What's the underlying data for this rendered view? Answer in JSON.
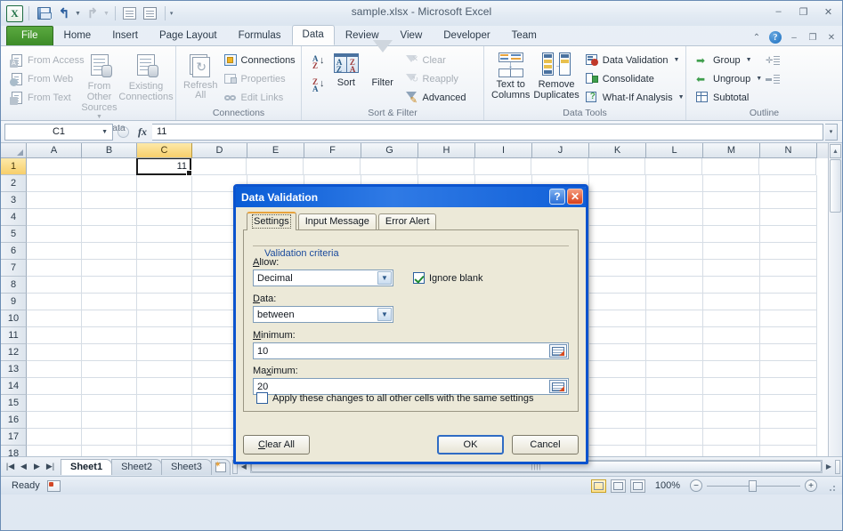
{
  "window": {
    "title": "sample.xlsx - Microsoft Excel",
    "minimize": "–",
    "maximize": "❐",
    "close": "✕"
  },
  "quick_access": {
    "logo": "X",
    "save": "save-icon",
    "undo": "↰",
    "redo": "↳",
    "customize": "▾"
  },
  "ribbon": {
    "tabs": [
      {
        "label": "File",
        "kind": "file"
      },
      {
        "label": "Home",
        "kind": "normal"
      },
      {
        "label": "Insert",
        "kind": "normal"
      },
      {
        "label": "Page Layout",
        "kind": "normal"
      },
      {
        "label": "Formulas",
        "kind": "normal"
      },
      {
        "label": "Data",
        "kind": "active"
      },
      {
        "label": "Review",
        "kind": "normal"
      },
      {
        "label": "View",
        "kind": "normal"
      },
      {
        "label": "Developer",
        "kind": "normal"
      },
      {
        "label": "Team",
        "kind": "normal"
      }
    ],
    "right_controls": {
      "collapse_ribbon": "⌃",
      "help": "?",
      "minimize_window": "–",
      "restore_window": "❐",
      "close_window": "✕"
    },
    "groups": [
      {
        "title": "Get External Data",
        "small": [
          "From Access",
          "From Web",
          "From Text"
        ],
        "large": [
          "From Other Sources",
          "Existing Connections"
        ]
      },
      {
        "title": "Connections",
        "refresh": "Refresh All",
        "small": [
          "Connections",
          "Properties",
          "Edit Links"
        ]
      },
      {
        "title": "Sort & Filter",
        "sort_az": "A→Z",
        "sort_za": "Z→A",
        "sort": "Sort",
        "filter": "Filter",
        "small": [
          "Clear",
          "Reapply",
          "Advanced"
        ]
      },
      {
        "title": "Data Tools",
        "large": [
          "Text to Columns",
          "Remove Duplicates"
        ],
        "small": [
          "Data Validation",
          "Consolidate",
          "What-If Analysis"
        ]
      },
      {
        "title": "Outline",
        "small": [
          "Group",
          "Ungroup",
          "Subtotal"
        ],
        "show_detail": "show-detail-icon",
        "hide_detail": "hide-detail-icon"
      }
    ]
  },
  "formula_bar": {
    "name_box": "C1",
    "cancel": "✕",
    "enter": "✓",
    "fx": "fx",
    "value": "11",
    "expand": "▾"
  },
  "grid": {
    "columns": [
      "A",
      "B",
      "C",
      "D",
      "E",
      "F",
      "G",
      "H",
      "I",
      "J",
      "K",
      "L",
      "M",
      "N"
    ],
    "selected_column": "C",
    "rows": [
      "1",
      "2",
      "3",
      "4",
      "5",
      "6",
      "7",
      "8",
      "9",
      "10",
      "11",
      "12",
      "13",
      "14",
      "15",
      "16",
      "17",
      "18"
    ],
    "selected_row": "1",
    "active_cell": {
      "ref": "C1",
      "value": "11"
    }
  },
  "sheet_tabs": {
    "nav": [
      "|◀",
      "◀",
      "▶",
      "▶|"
    ],
    "tabs": [
      "Sheet1",
      "Sheet2",
      "Sheet3"
    ],
    "active": "Sheet1",
    "insert_sheet": "insert-worksheet-icon"
  },
  "status_bar": {
    "mode": "Ready",
    "macro_record": "record-macro-icon",
    "views": [
      "Normal",
      "Page Layout",
      "Page Break Preview"
    ],
    "active_view": "Normal",
    "zoom": "100%",
    "zoom_out": "−",
    "zoom_in": "+"
  },
  "dialog": {
    "title": "Data Validation",
    "help_button": "?",
    "close_button": "✕",
    "tabs": [
      "Settings",
      "Input Message",
      "Error Alert"
    ],
    "active_tab": "Settings",
    "legend": "Validation criteria",
    "allow_label": "Allow:",
    "allow_value": "Decimal",
    "ignore_blank_label": "Ignore blank",
    "ignore_blank_checked": true,
    "data_label": "Data:",
    "data_value": "between",
    "minimum_label": "Minimum:",
    "minimum_value": "10",
    "maximum_label": "Maximum:",
    "maximum_value": "20",
    "apply_all_label": "Apply these changes to all other cells with the same settings",
    "apply_all_checked": false,
    "buttons": {
      "clear_all": "Clear All",
      "ok": "OK",
      "cancel": "Cancel"
    }
  },
  "colors": {
    "accent_green": "#3d8b28",
    "title_blue": "#0a5cd6",
    "selection_gold": "#f7cf6b",
    "link_blue": "#1a4a9c"
  }
}
